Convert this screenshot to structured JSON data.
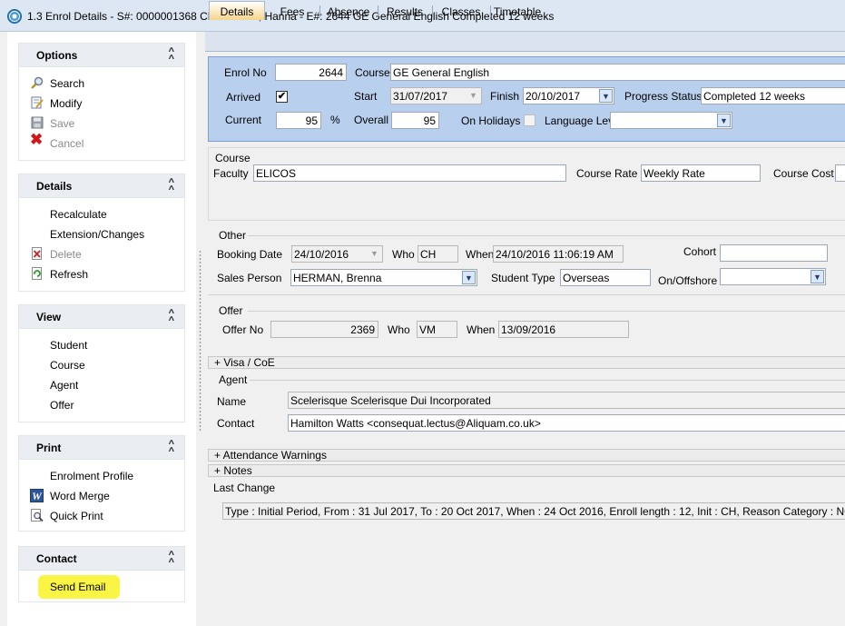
{
  "window": {
    "title": "1.3 Enrol Details - S#: 0000001368 CHRISTIAN, Hanna - E#: 2644 GE General English Completed 12 weeks"
  },
  "sidebar": {
    "options": {
      "header": "Options",
      "items": [
        {
          "label": "Search",
          "icon": "magnifier-icon"
        },
        {
          "label": "Modify",
          "icon": "edit-icon"
        },
        {
          "label": "Save",
          "icon": "floppy-icon"
        },
        {
          "label": "Cancel",
          "icon": "red-x-icon"
        }
      ]
    },
    "details": {
      "header": "Details",
      "items": [
        {
          "label": "Recalculate"
        },
        {
          "label": "Extension/Changes"
        },
        {
          "label": "Delete",
          "icon": "delete-doc-icon"
        },
        {
          "label": "Refresh",
          "icon": "refresh-icon"
        }
      ]
    },
    "view": {
      "header": "View",
      "items": [
        {
          "label": "Student"
        },
        {
          "label": "Course"
        },
        {
          "label": "Agent"
        },
        {
          "label": "Offer"
        }
      ]
    },
    "print": {
      "header": "Print",
      "items": [
        {
          "label": "Enrolment Profile"
        },
        {
          "label": "Word Merge",
          "icon": "word-icon"
        },
        {
          "label": "Quick Print",
          "icon": "print-preview-icon"
        }
      ]
    },
    "contact": {
      "header": "Contact",
      "items": [
        {
          "label": "Send Email"
        }
      ]
    }
  },
  "tabs": [
    {
      "label": "Details",
      "active": true
    },
    {
      "label": "Fees"
    },
    {
      "label": "Absence"
    },
    {
      "label": "Results"
    },
    {
      "label": "Classes"
    },
    {
      "label": "Timetable"
    }
  ],
  "enrol": {
    "enrol_no_label": "Enrol No",
    "enrol_no": "2644",
    "course_label": "Course",
    "course": "GE General English",
    "arrived_label": "Arrived",
    "arrived_check": "✔",
    "start_label": "Start",
    "start": "31/07/2017",
    "finish_label": "Finish",
    "finish": "20/10/2017",
    "progress_label": "Progress Status",
    "progress": "Completed 12 weeks",
    "current_label": "Current",
    "current": "95",
    "percent": "%",
    "overall_label": "Overall",
    "overall": "95",
    "holidays_label": "On Holidays",
    "language_label": "Language Leve",
    "language": ""
  },
  "course_section": {
    "title": "Course",
    "faculty_label": "Faculty",
    "faculty": "ELICOS",
    "rate_label": "Course Rate",
    "rate": "Weekly Rate",
    "cost_label": "Course Cost",
    "cost": ""
  },
  "other": {
    "title": "Other",
    "booking_label": "Booking Date",
    "booking": "24/10/2016",
    "who_label": "Who",
    "who": "CH",
    "when_label": "When",
    "when": "24/10/2016 11:06:19 AM",
    "cohort_label": "Cohort",
    "cohort": "",
    "sales_label": "Sales Person",
    "sales": "HERMAN, Brenna",
    "student_type_label": "Student Type",
    "student_type": "Overseas",
    "onoff_label": "On/Offshore",
    "onoff": ""
  },
  "offer": {
    "title": "Offer",
    "no_label": "Offer No",
    "no": "2369",
    "who_label": "Who",
    "who": "VM",
    "when_label": "When",
    "when": "13/09/2016"
  },
  "visa": {
    "label": "+  Visa / CoE"
  },
  "agent": {
    "title": "Agent",
    "name_label": "Name",
    "name": "Scelerisque Scelerisque Dui Incorporated",
    "contact_label": "Contact",
    "contact": "Hamilton Watts <consequat.lectus@Aliquam.co.uk>"
  },
  "attendance": {
    "label": "+  Attendance Warnings"
  },
  "notes": {
    "label": "+  Notes"
  },
  "last_change": {
    "title": "Last Change",
    "text": "Type : Initial Period,   From : 31 Jul 2017,   To : 20 Oct 2017,   When : 24 Oct 2016,   Enroll length : 12,   Init : CH,   Reason Category : NONE"
  },
  "colors": {
    "highlight": "#faf33a",
    "header_panel": "#b9cfee",
    "active_tab": "#f6d58b"
  }
}
